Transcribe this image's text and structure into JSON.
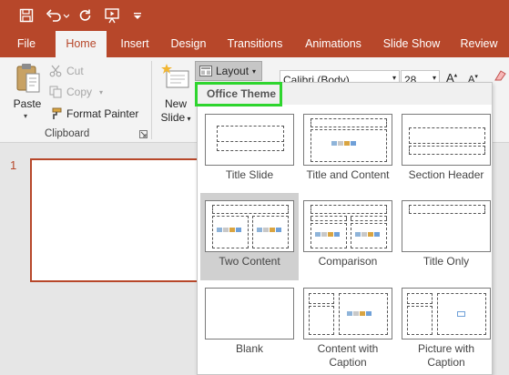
{
  "quick_access": {
    "icons": [
      "save-icon",
      "undo-icon",
      "redo-icon",
      "present-from-beginning-icon",
      "customize-qat-icon"
    ]
  },
  "tabs": [
    "File",
    "Home",
    "Insert",
    "Design",
    "Transitions",
    "Animations",
    "Slide Show",
    "Review"
  ],
  "active_tab": "Home",
  "clipboard": {
    "paste": "Paste",
    "cut": "Cut",
    "copy": "Copy",
    "format_painter": "Format Painter",
    "group_label": "Clipboard"
  },
  "slides": {
    "new_slide_line1": "New",
    "new_slide_line2": "Slide",
    "layout_label": "Layout",
    "slide_number": "1"
  },
  "font": {
    "name": "Calibri (Body)",
    "size": "28"
  },
  "layout_dropdown": {
    "title": "Office Theme",
    "selected": "Two Content",
    "layouts": [
      {
        "label": "Title Slide"
      },
      {
        "label": "Title and Content"
      },
      {
        "label": "Section Header"
      },
      {
        "label": "Two Content"
      },
      {
        "label": "Comparison"
      },
      {
        "label": "Title Only"
      },
      {
        "label": "Blank"
      },
      {
        "label": "Content with Caption"
      },
      {
        "label": "Picture with Caption"
      }
    ]
  },
  "colors": {
    "accent": "#b7472a",
    "highlight": "#2ed52e",
    "ribbon": "#f3f3f3",
    "selected_cell": "#d0d0d0"
  }
}
